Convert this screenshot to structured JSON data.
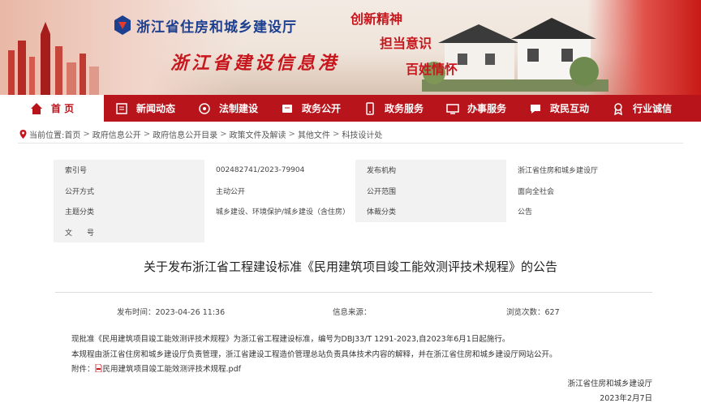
{
  "site": {
    "name": "浙江省住房和城乡建设厅",
    "subtitle": "浙江省建设信息港",
    "slogans": [
      "创新精神",
      "担当意识",
      "百姓情怀"
    ]
  },
  "nav": {
    "items": [
      {
        "label": "首 页",
        "icon": "home-icon"
      },
      {
        "label": "新闻动态",
        "icon": "news-icon"
      },
      {
        "label": "法制建设",
        "icon": "law-icon"
      },
      {
        "label": "政务公开",
        "icon": "disclosure-icon"
      },
      {
        "label": "政务服务",
        "icon": "service-icon"
      },
      {
        "label": "办事服务",
        "icon": "handle-icon"
      },
      {
        "label": "政民互动",
        "icon": "interaction-icon"
      },
      {
        "label": "行业诚信",
        "icon": "credit-icon"
      }
    ]
  },
  "breadcrumb": {
    "prefix": "当前位置:",
    "items": [
      "首页",
      "政府信息公开",
      "政府信息公开目录",
      "政策文件及解读",
      "其他文件",
      "科技设计处"
    ]
  },
  "meta": {
    "index_label": "索引号",
    "index_value": "002482741/2023-79904",
    "publisher_label": "发布机构",
    "publisher_value": "浙江省住房和城乡建设厅",
    "mode_label": "公开方式",
    "mode_value": "主动公开",
    "scope_label": "公开范围",
    "scope_value": "面向全社会",
    "topic_label": "主题分类",
    "topic_value": "城乡建设、环境保护/城乡建设（含住房）",
    "genre_label": "体裁分类",
    "genre_value": "公告",
    "docno_label": "文　　号",
    "docno_value": ""
  },
  "doc": {
    "title": "关于发布浙江省工程建设标准《民用建筑项目竣工能效测评技术规程》的公告",
    "publish_time_label": "发布时间：",
    "publish_time": "2023-04-26 11:36",
    "source_label": "信息来源：",
    "source": "",
    "views_label": "浏览次数：",
    "views": "627",
    "para1": "现批准《民用建筑项目竣工能效测评技术规程》为浙江省工程建设标准，编号为DBJ33/T 1291-2023,自2023年6月1日起施行。",
    "para2": "本规程由浙江省住房和城乡建设厅负责管理，浙江省建设工程造价管理总站负责具体技术内容的解释，并在浙江省住房和城乡建设厅网站公开。",
    "attach_label": "附件：",
    "attach_name": "民用建筑项目竣工能效测评技术规程.pdf",
    "sign_org": "浙江省住房和城乡建设厅",
    "sign_date": "2023年2月7日"
  },
  "colors": {
    "brand_red": "#b8141b",
    "logo_blue": "#1d3f8f"
  }
}
